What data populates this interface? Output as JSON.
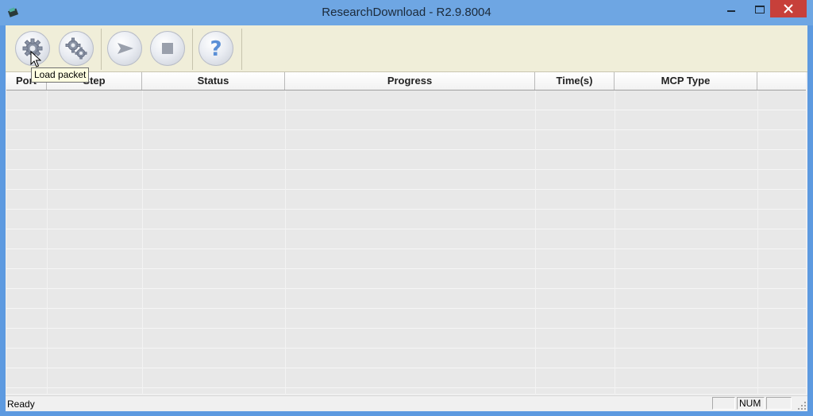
{
  "window": {
    "title": "ResearchDownload - R2.9.8004"
  },
  "toolbar": {
    "buttons": [
      {
        "name": "load-packet",
        "icon": "gear-icon"
      },
      {
        "name": "settings",
        "icon": "gears-icon"
      },
      {
        "name": "start",
        "icon": "play-arrow-icon"
      },
      {
        "name": "stop",
        "icon": "stop-icon"
      },
      {
        "name": "help",
        "icon": "question-icon"
      }
    ],
    "tooltip": "Load packet"
  },
  "table": {
    "columns": [
      "Port",
      "Step",
      "Status",
      "Progress",
      "Time(s)",
      "MCP Type"
    ]
  },
  "statusbar": {
    "text": "Ready",
    "panels": [
      "",
      "NUM",
      ""
    ]
  },
  "colors": {
    "titlebar": "#6ea6e3",
    "close_button": "#c7403a",
    "toolbar_bg": "#f0eed9",
    "grid_bg": "#e8e8e8"
  }
}
